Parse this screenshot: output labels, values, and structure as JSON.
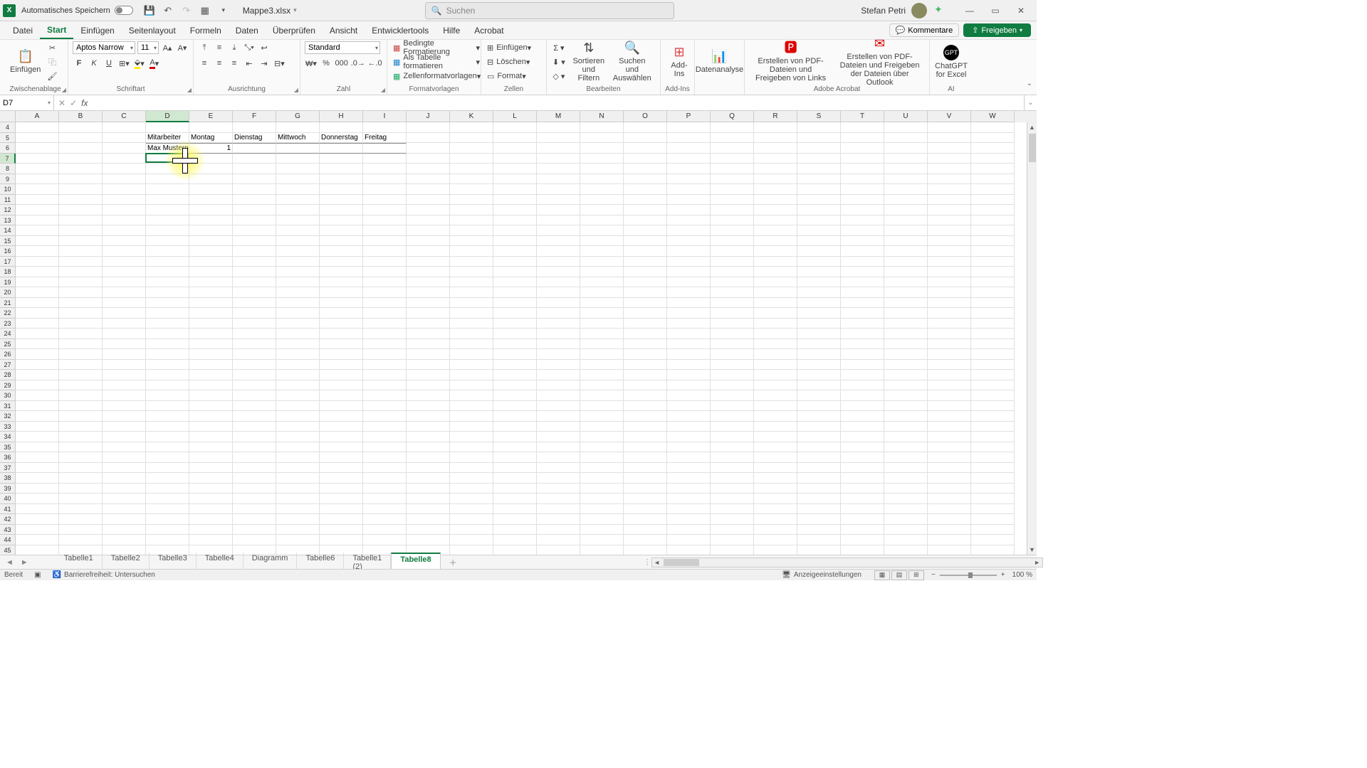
{
  "title_bar": {
    "autosave_label": "Automatisches Speichern",
    "autosave_on": false,
    "filename": "Mappe3.xlsx",
    "search_placeholder": "Suchen",
    "user_name": "Stefan Petri"
  },
  "ribbon_tabs": {
    "file": "Datei",
    "tabs": [
      "Start",
      "Einfügen",
      "Seitenlayout",
      "Formeln",
      "Daten",
      "Überprüfen",
      "Ansicht",
      "Entwicklertools",
      "Hilfe",
      "Acrobat"
    ],
    "active": "Start",
    "comments": "Kommentare",
    "share": "Freigeben"
  },
  "ribbon": {
    "clipboard": {
      "paste": "Einfügen",
      "group": "Zwischenablage"
    },
    "font": {
      "name": "Aptos Narrow",
      "size": "11",
      "bold": "F",
      "italic": "K",
      "underline": "U",
      "group": "Schriftart"
    },
    "alignment": {
      "group": "Ausrichtung"
    },
    "number": {
      "format": "Standard",
      "group": "Zahl"
    },
    "styles": {
      "cond": "Bedingte Formatierung",
      "table": "Als Tabelle formatieren",
      "cell": "Zellenformatvorlagen",
      "group": "Formatvorlagen"
    },
    "cells": {
      "insert": "Einfügen",
      "delete": "Löschen",
      "format": "Format",
      "group": "Zellen"
    },
    "editing": {
      "sort": "Sortieren und Filtern",
      "find": "Suchen und Auswählen",
      "group": "Bearbeiten"
    },
    "addins": {
      "label": "Add-Ins",
      "group": "Add-Ins"
    },
    "analysis": {
      "label": "Datenanalyse"
    },
    "acrobat": {
      "pdf_links": "Erstellen von PDF-Dateien und Freigeben von Links",
      "pdf_outlook": "Erstellen von PDF-Dateien und Freigeben der Dateien über Outlook",
      "group": "Adobe Acrobat"
    },
    "ai": {
      "chatgpt": "ChatGPT for Excel",
      "group": "AI"
    }
  },
  "name_box": "D7",
  "formula": "",
  "columns": [
    "A",
    "B",
    "C",
    "D",
    "E",
    "F",
    "G",
    "H",
    "I",
    "J",
    "K",
    "L",
    "M",
    "N",
    "O",
    "P",
    "Q",
    "R",
    "S",
    "T",
    "U",
    "V",
    "W"
  ],
  "first_row": 4,
  "row_count": 42,
  "table": {
    "headers_row": 5,
    "data_row": 6,
    "headers": [
      "Mitarbeiter",
      "Montag",
      "Dienstag",
      "Mittwoch",
      "Donnerstag",
      "Freitag"
    ],
    "data": [
      "Max Mustern",
      "1",
      "",
      "",
      "",
      ""
    ]
  },
  "active_cell": {
    "col": "D",
    "row": 7
  },
  "sheet_tabs": [
    "Tabelle1",
    "Tabelle2",
    "Tabelle3",
    "Tabelle4",
    "Diagramm",
    "Tabelle6",
    "Tabelle1 (2)",
    "Tabelle8"
  ],
  "active_sheet": "Tabelle8",
  "status": {
    "ready": "Bereit",
    "accessibility": "Barrierefreiheit: Untersuchen",
    "display_settings": "Anzeigeeinstellungen",
    "zoom": "100 %"
  }
}
